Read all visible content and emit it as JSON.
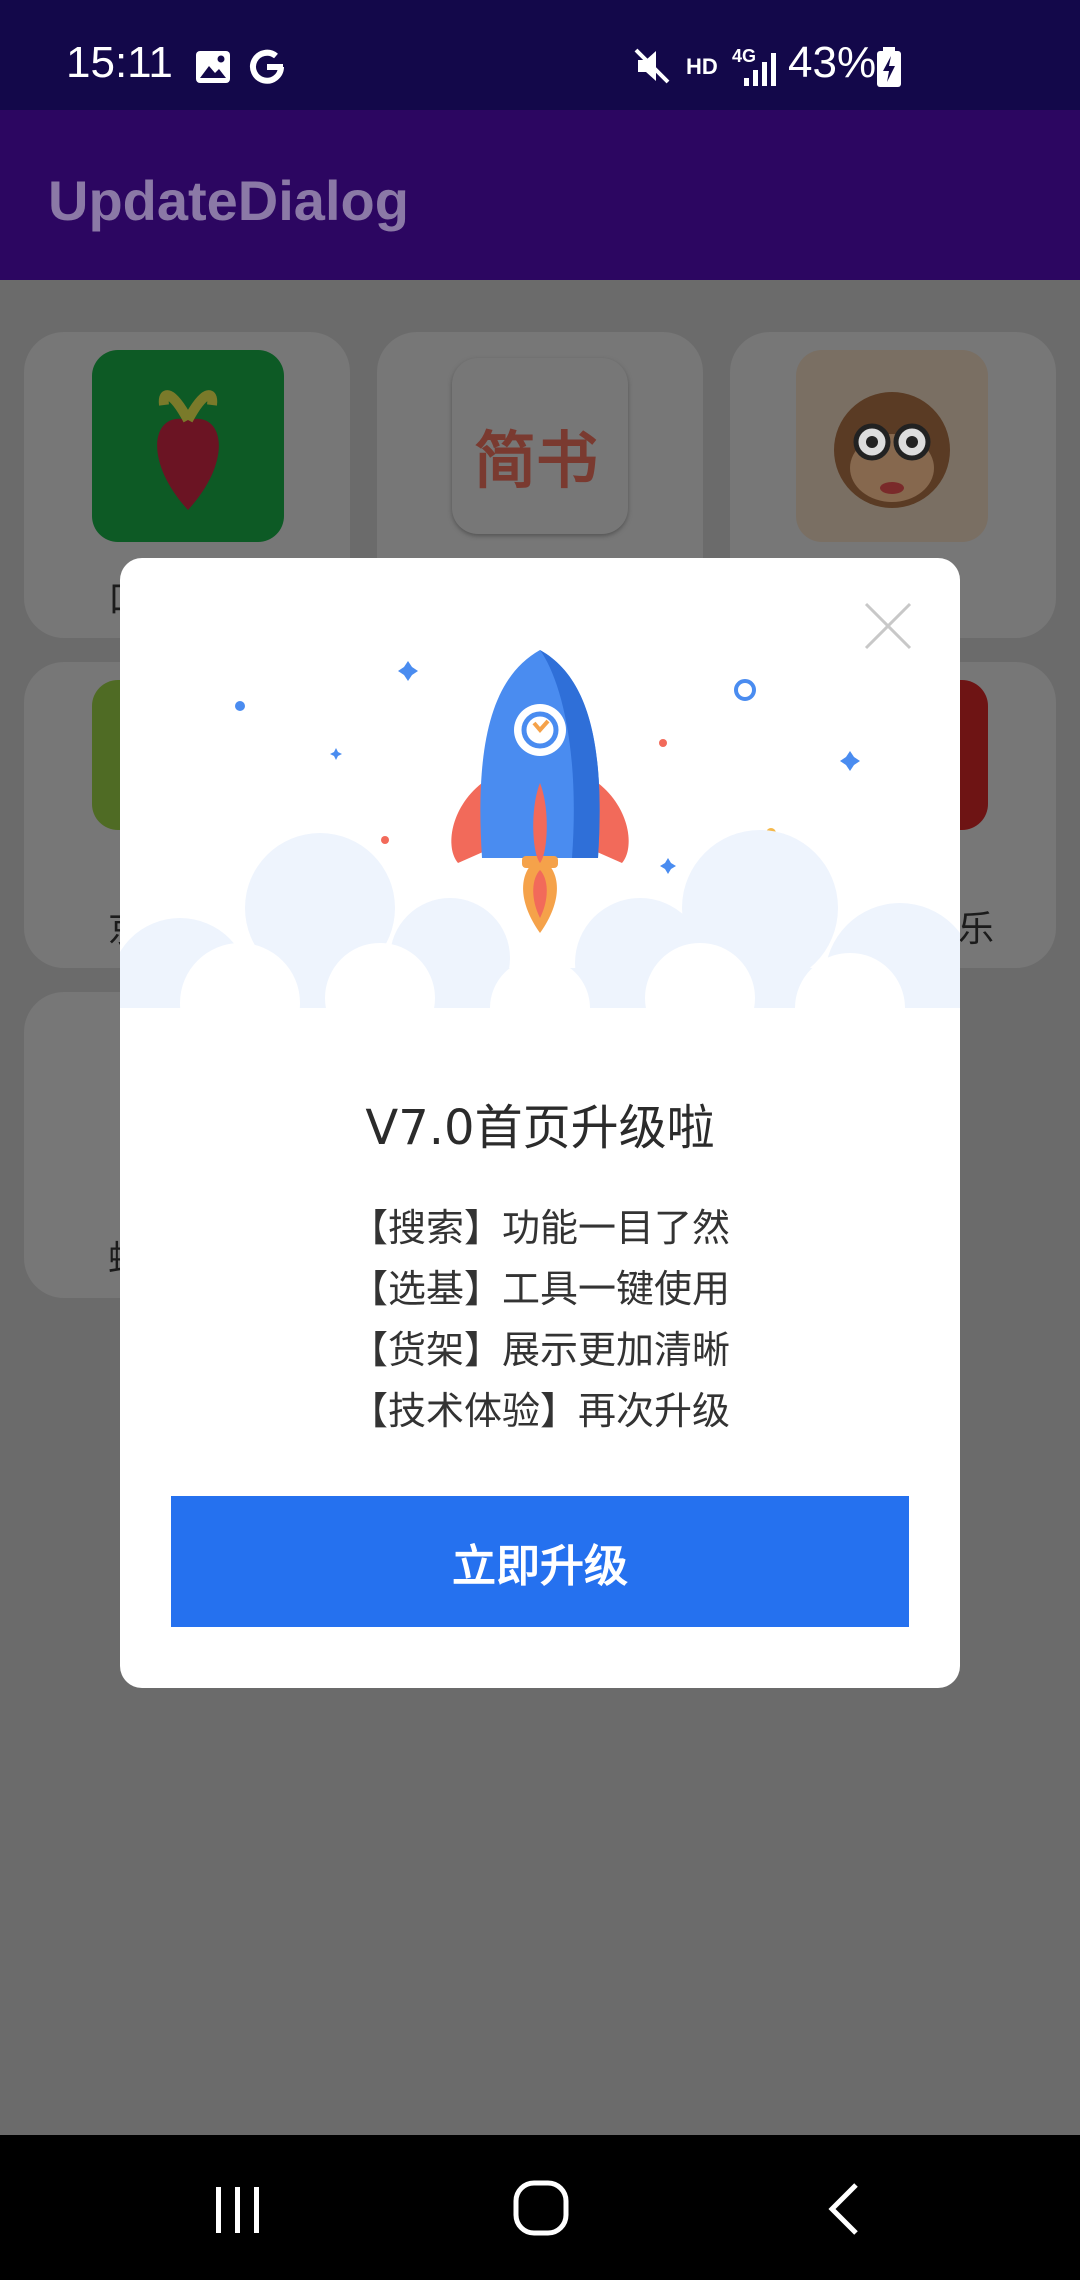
{
  "status_bar": {
    "time": "15:11",
    "network": "HD",
    "signal": "4G",
    "battery": "43%",
    "icons": [
      "gallery-icon",
      "google-icon",
      "mute-icon",
      "signal-icon",
      "battery-charging-icon"
    ]
  },
  "app_bar": {
    "title": "UpdateDialog"
  },
  "apps": [
    {
      "label": "口",
      "icon": "radish-app-icon"
    },
    {
      "label": "简书",
      "icon": "jianshu-app-icon"
    },
    {
      "label": "",
      "icon": "csdn-monkey-app-icon"
    },
    {
      "label": "京",
      "icon": "green-app-icon"
    },
    {
      "label": "乐",
      "icon": "red-app-icon"
    },
    {
      "label": "蛇",
      "icon": "blank-app-icon"
    }
  ],
  "dialog": {
    "title": "V7.0首页升级啦",
    "features": [
      "【搜索】功能一目了然",
      "【选基】工具一键使用",
      "【货架】展示更加清晰",
      "【技术体验】再次升级"
    ],
    "upgrade_label": "立即升级",
    "colors": {
      "button": "#2571ef",
      "rocket": "#4a8cf0",
      "fins": "#f26a5a"
    }
  },
  "nav": {
    "buttons": [
      "recents-icon",
      "home-icon",
      "back-icon"
    ]
  }
}
